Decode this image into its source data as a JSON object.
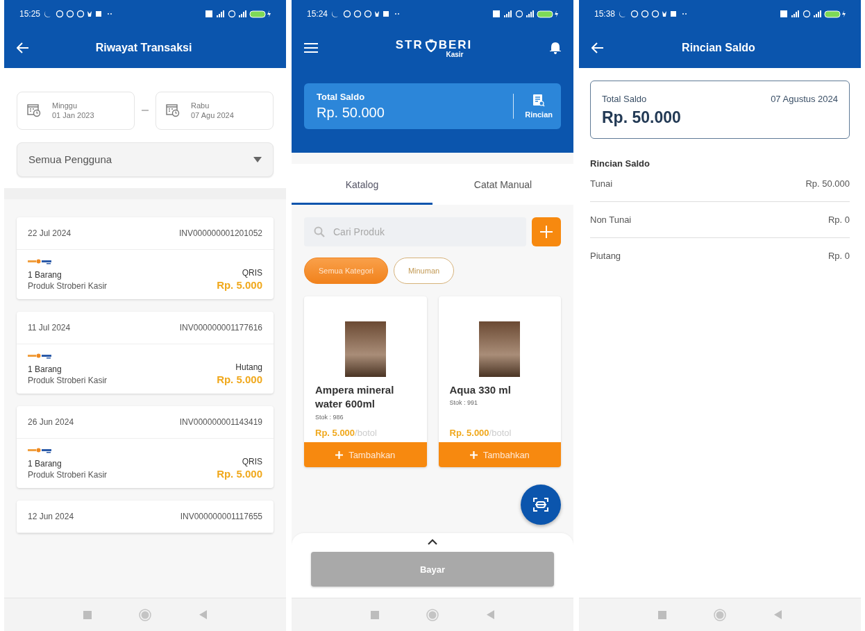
{
  "transaction_history": {
    "status_bar": {
      "time": "15:25"
    },
    "title": "Riwayat Transaksi",
    "date_range": {
      "start": {
        "day": "Minggu",
        "date": "01 Jan 2023"
      },
      "end": {
        "day": "Rabu",
        "date": "07 Agu 2024"
      }
    },
    "user_filter": "Semua Pengguna",
    "transactions": [
      {
        "date": "22 Jul 2024",
        "invoice": "INV000000001201052",
        "items": "1 Barang",
        "description": "Produk Stroberi Kasir",
        "payment": "QRIS",
        "amount": "Rp. 5.000"
      },
      {
        "date": "11 Jul 2024",
        "invoice": "INV000000001177616",
        "items": "1 Barang",
        "description": "Produk Stroberi Kasir",
        "payment": "Hutang",
        "amount": "Rp. 5.000"
      },
      {
        "date": "26 Jun 2024",
        "invoice": "INV000000001143419",
        "items": "1 Barang",
        "description": "Produk Stroberi Kasir",
        "payment": "QRIS",
        "amount": "Rp. 5.000"
      },
      {
        "date": "12 Jun 2024",
        "invoice": "INV000000001117655"
      }
    ]
  },
  "cashier_home": {
    "status_bar": {
      "time": "15:24"
    },
    "logo": {
      "left": "STR",
      "right": "BERI",
      "sub": "Kasir"
    },
    "balance_card": {
      "label": "Total Saldo",
      "amount": "Rp. 50.000",
      "action": "Rincian"
    },
    "tabs": [
      {
        "label": "Katalog",
        "selected": true
      },
      {
        "label": "Catat Manual",
        "selected": false
      }
    ],
    "search": {
      "placeholder": "Cari Produk"
    },
    "categories": [
      {
        "label": "Semua Kategori",
        "selected": true
      },
      {
        "label": "Minuman",
        "selected": false
      }
    ],
    "products": [
      {
        "name": "Ampera mineral water 600ml",
        "stock": "Stok : 986",
        "price": "Rp. 5.000",
        "unit": "/botol",
        "button": "Tambahkan"
      },
      {
        "name": "Aqua 330 ml",
        "stock": "Stok : 991",
        "price": "Rp. 5.000",
        "unit": "/botol",
        "button": "Tambahkan"
      }
    ],
    "pay_button": {
      "label": "Bayar",
      "disabled": true
    }
  },
  "balance_detail": {
    "status_bar": {
      "time": "15:38"
    },
    "title": "Rincian Saldo",
    "summary": {
      "label": "Total Saldo",
      "date": "07 Agustus 2024",
      "amount": "Rp. 50.000"
    },
    "section_title": "Rincian Saldo",
    "rows": [
      {
        "label": "Tunai",
        "value": "Rp. 50.000"
      },
      {
        "label": "Non Tunai",
        "value": "Rp. 0"
      },
      {
        "label": "Piutang",
        "value": "Rp. 0"
      }
    ]
  }
}
